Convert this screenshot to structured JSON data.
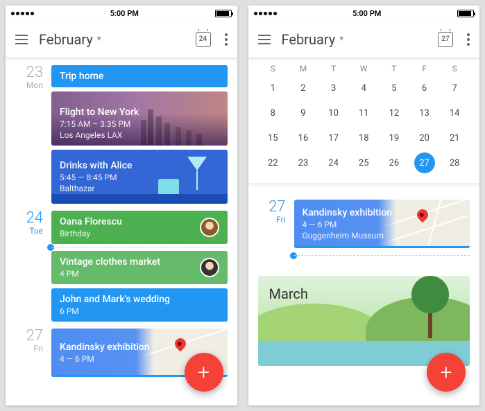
{
  "statusbar": {
    "time": "5:00 PM"
  },
  "left": {
    "header": {
      "month": "February",
      "today_day": "24"
    },
    "days": [
      {
        "num": "23",
        "dow": "Mon",
        "active": false,
        "events": [
          {
            "kind": "blue",
            "t1": "Trip home"
          },
          {
            "kind": "img-nyc",
            "t1": "Flight to New York",
            "t2": "7:15 AM – 3:35 PM",
            "t3": "Los Angeles LAX"
          },
          {
            "kind": "img-drinks",
            "t1": "Drinks with Alice",
            "t2": "5:45 — 8:45 PM",
            "t3": "Balthazar"
          }
        ]
      },
      {
        "num": "24",
        "dow": "Tue",
        "active": true,
        "events": [
          {
            "kind": "green",
            "t1": "Oana Florescu",
            "t2": "Birthday",
            "avatar": "a1"
          }
        ],
        "after_now": [
          {
            "kind": "green2",
            "t1": "Vintage clothes market",
            "t2": "4 PM",
            "avatar": "a2"
          },
          {
            "kind": "blue",
            "t1": "John and Mark's wedding",
            "t2": "6 PM"
          }
        ]
      },
      {
        "num": "27",
        "dow": "Fri",
        "active": false,
        "events": [
          {
            "kind": "map",
            "t1": "Kandinsky exhibition",
            "t2": "4 — 6 PM"
          }
        ]
      }
    ]
  },
  "right": {
    "header": {
      "month": "February",
      "today_day": "27"
    },
    "weekdays": [
      "S",
      "M",
      "T",
      "W",
      "T",
      "F",
      "S"
    ],
    "days": [
      1,
      2,
      3,
      4,
      5,
      6,
      7,
      8,
      9,
      10,
      11,
      12,
      13,
      14,
      15,
      16,
      17,
      18,
      19,
      20,
      21,
      22,
      23,
      24,
      25,
      26,
      27,
      28
    ],
    "selected": 27,
    "schedule": {
      "num": "27",
      "dow": "Fri",
      "event": {
        "t1": "Kandinsky exhibition",
        "t2": "4 — 6 PM",
        "t3": "Guggenheim Museum"
      }
    },
    "next_month": "March"
  }
}
